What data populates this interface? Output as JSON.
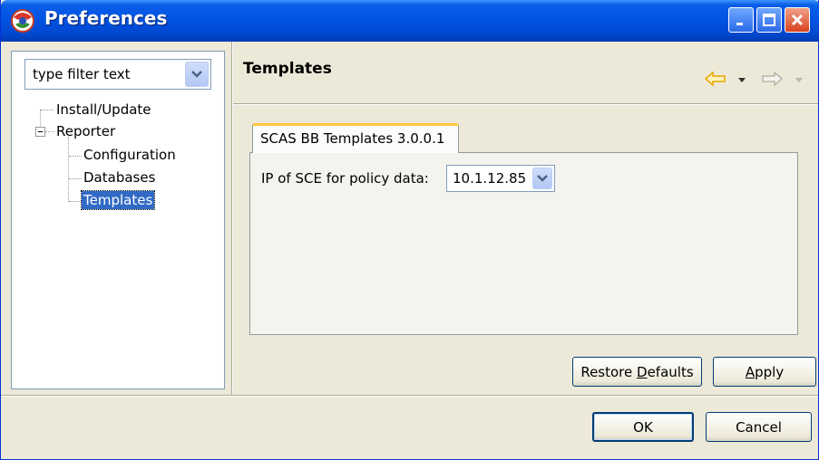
{
  "window": {
    "title": "Preferences"
  },
  "filter": {
    "placeholder": "type filter text"
  },
  "tree": {
    "items": [
      {
        "label": "Install/Update"
      },
      {
        "label": "Reporter"
      },
      {
        "label": "Configuration"
      },
      {
        "label": "Databases"
      },
      {
        "label": "Templates",
        "selected": true
      }
    ]
  },
  "page": {
    "title": "Templates",
    "tab_label": "SCAS BB Templates 3.0.0.1",
    "field_label": "IP of SCE for policy data:",
    "ip_value": "10.1.12.85"
  },
  "buttons": {
    "restore_prefix": "Restore ",
    "restore_mnemonic": "D",
    "restore_suffix": "efaults",
    "apply_mnemonic": "A",
    "apply_suffix": "pply",
    "ok": "OK",
    "cancel": "Cancel"
  },
  "colors": {
    "titlebar": "#0055e5",
    "selection": "#316ac5",
    "tab_accent": "#ffc83c",
    "nav_back_arrow": "#e8a800"
  }
}
